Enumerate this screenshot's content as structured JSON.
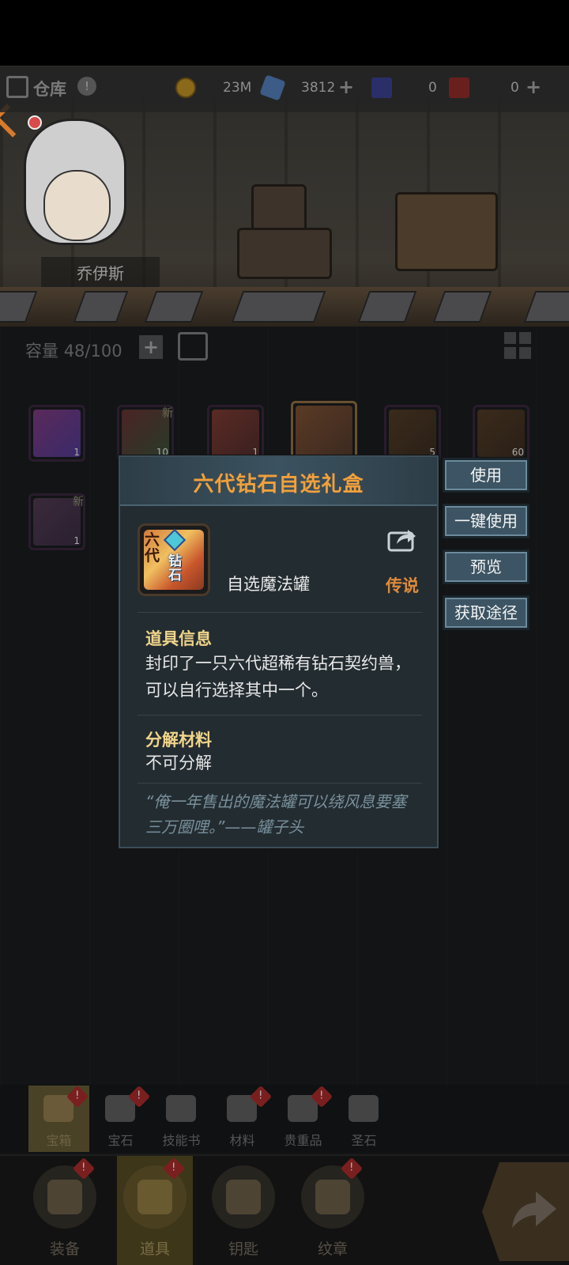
{
  "header": {
    "title": "仓库",
    "gold": "23M",
    "crystals": "3812",
    "ticket_a": "0",
    "ticket_b": "0"
  },
  "hero": {
    "name": "乔伊斯"
  },
  "inventory": {
    "capacity_label": "容量",
    "capacity_value": "48/100",
    "slots": [
      {
        "count": "1",
        "is_new": false
      },
      {
        "count": "10",
        "is_new": true
      },
      {
        "count": "1",
        "is_new": false
      },
      {
        "count": "",
        "is_new": false,
        "selected": true
      },
      {
        "count": "5",
        "is_new": false
      },
      {
        "count": "60",
        "is_new": false
      },
      {
        "count": "1",
        "is_new": true
      }
    ],
    "new_label": "新"
  },
  "tooltip": {
    "title": "六代钻石自选礼盒",
    "item_name": "自选魔法罐",
    "rarity": "传说",
    "icon_text_top": "六代",
    "icon_text_center": "钻石",
    "info_title": "道具信息",
    "info_body": "封印了一只六代超稀有钻石契约兽，可以自行选择其中一个。",
    "decompose_title": "分解材料",
    "decompose_body": "不可分解",
    "quote": "“俺一年售出的魔法罐可以绕风息要塞三万圈哩。”——罐子头"
  },
  "actions": {
    "use": "使用",
    "use_all": "一键使用",
    "preview": "预览",
    "source": "获取途径"
  },
  "categories": [
    {
      "label": "宝箱",
      "badge": "!"
    },
    {
      "label": "宝石",
      "badge": "!"
    },
    {
      "label": "技能书",
      "badge": ""
    },
    {
      "label": "材料",
      "badge": "!"
    },
    {
      "label": "贵重品",
      "badge": "!"
    },
    {
      "label": "圣石",
      "badge": ""
    }
  ],
  "nav": [
    {
      "label": "装备",
      "badge": "!"
    },
    {
      "label": "道具",
      "badge": "!"
    },
    {
      "label": "钥匙",
      "badge": ""
    },
    {
      "label": "纹章",
      "badge": "!"
    }
  ]
}
